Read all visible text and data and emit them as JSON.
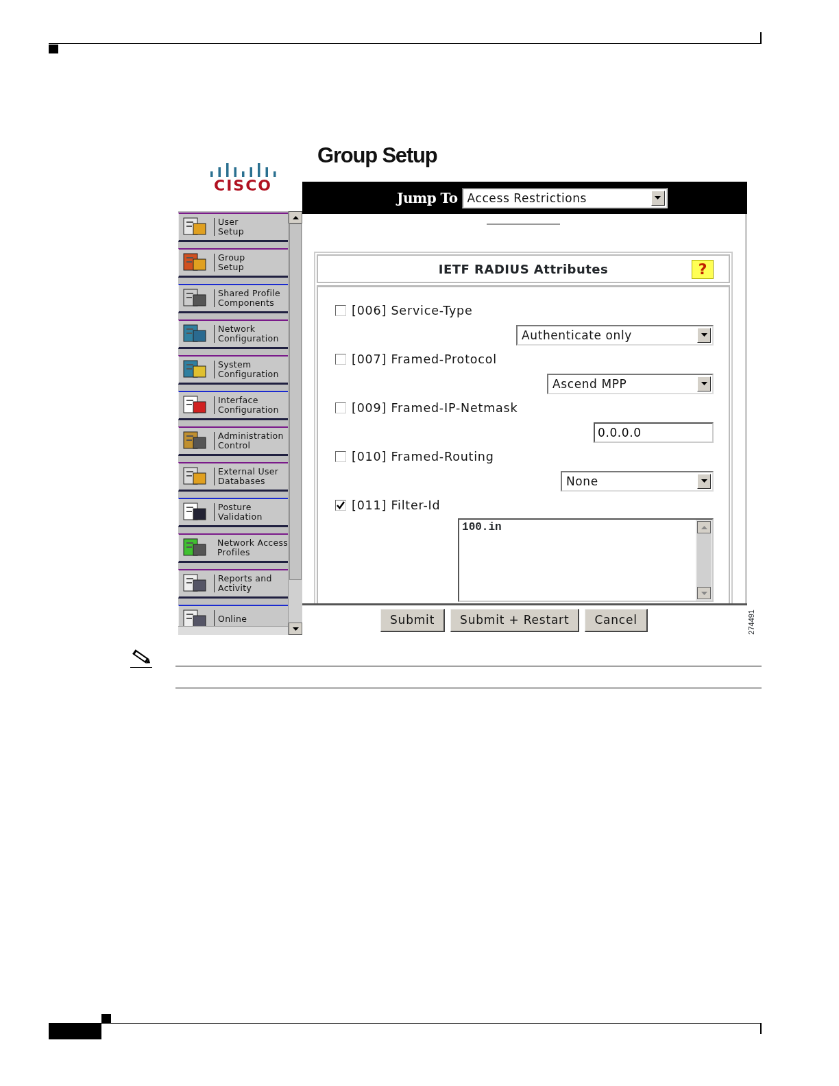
{
  "logo": {
    "text": "CISCO"
  },
  "nav": {
    "items": [
      {
        "kind": "user",
        "lines": [
          "User",
          "Setup"
        ]
      },
      {
        "kind": "group",
        "lines": [
          "Group",
          "Setup"
        ]
      },
      {
        "kind": "gears",
        "lines": [
          "Shared Profile",
          "Components"
        ]
      },
      {
        "kind": "network",
        "lines": [
          "Network",
          "Configuration"
        ]
      },
      {
        "kind": "system",
        "lines": [
          "System",
          "Configuration"
        ]
      },
      {
        "kind": "interface",
        "lines": [
          "Interface",
          "Configuration"
        ]
      },
      {
        "kind": "admin",
        "lines": [
          "Administration",
          "Control"
        ]
      },
      {
        "kind": "database",
        "lines": [
          "External User",
          "Databases"
        ]
      },
      {
        "kind": "posture",
        "lines": [
          "Posture",
          "Validation"
        ]
      },
      {
        "kind": "nap",
        "lines": [
          "Network Access",
          "Profiles"
        ]
      },
      {
        "kind": "reports",
        "lines": [
          "Reports and",
          "Activity"
        ]
      },
      {
        "kind": "online",
        "lines": [
          "Online"
        ]
      }
    ]
  },
  "page_title": "Group Setup",
  "jump_to": {
    "label": "Jump To",
    "value": "Access Restrictions"
  },
  "panel": {
    "title": "IETF RADIUS Attributes",
    "help": "?"
  },
  "attributes": [
    {
      "code": "[006]",
      "name": "Service-Type",
      "checked": false,
      "kind": "select",
      "value": "Authenticate only"
    },
    {
      "code": "[007]",
      "name": "Framed-Protocol",
      "checked": false,
      "kind": "select",
      "value": "Ascend MPP"
    },
    {
      "code": "[009]",
      "name": "Framed-IP-Netmask",
      "checked": false,
      "kind": "text",
      "value": "0.0.0.0"
    },
    {
      "code": "[010]",
      "name": "Framed-Routing",
      "checked": false,
      "kind": "select",
      "value": "None"
    },
    {
      "code": "[011]",
      "name": "Filter-Id",
      "checked": true,
      "kind": "textarea",
      "value": "100.in"
    }
  ],
  "buttons": [
    "Submit",
    "Submit + Restart",
    "Cancel"
  ],
  "figure_number": "274491"
}
